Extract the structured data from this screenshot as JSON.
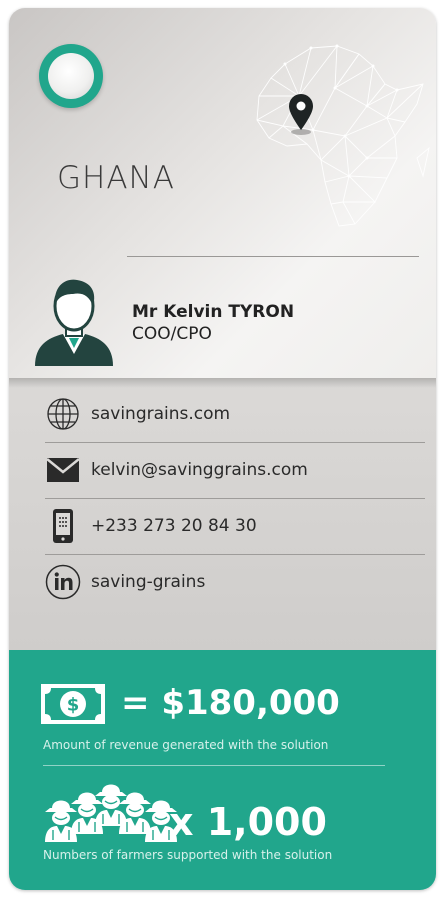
{
  "country": "GHANA",
  "person": {
    "name": "Mr Kelvin TYRON",
    "role": "COO/CPO"
  },
  "contacts": [
    {
      "icon": "globe-icon",
      "text": "savingrains.com"
    },
    {
      "icon": "envelope-icon",
      "text": "kelvin@savinggrains.com"
    },
    {
      "icon": "phone-icon",
      "text": "+233 273 20 84 30"
    },
    {
      "icon": "linkedin-icon",
      "text": "saving-grains"
    }
  ],
  "stats": {
    "revenue": {
      "value": "= $180,000",
      "label": "Amount of revenue generated with the solution"
    },
    "farmers": {
      "value": "x 1,000",
      "label": "Numbers of farmers supported with the solution"
    }
  },
  "colors": {
    "accent": "#21a68c",
    "dark": "#23443f",
    "text": "#2a2a2a"
  }
}
